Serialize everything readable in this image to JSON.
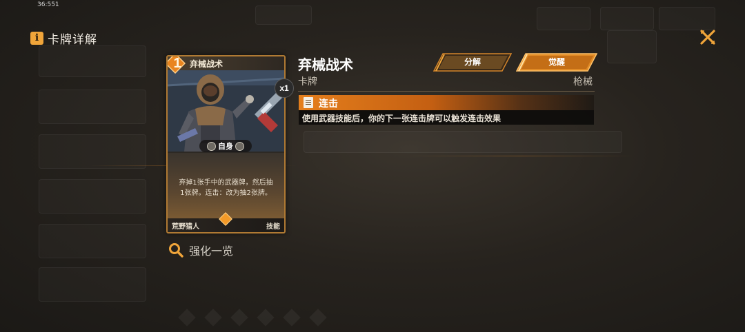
{
  "status": {
    "timestamp": "36:551"
  },
  "panel": {
    "title": "卡牌详解"
  },
  "card": {
    "name": "弃械战术",
    "cost": "1",
    "target": "自身",
    "description_line1": "弃掉1张手中的武器牌，然后抽",
    "description_line2": "1张牌。连击：改为抽2张牌。",
    "faction": "荒野猎人",
    "type": "技能",
    "count": "x1"
  },
  "search": {
    "label": "强化一览"
  },
  "detail": {
    "title": "弃械战术",
    "category": "卡牌",
    "subtype": "枪械",
    "buttons": {
      "decompose": "分解",
      "awaken": "觉醒"
    },
    "keyword": {
      "name": "连击",
      "description": "使用武器技能后，你的下一张连击牌可以触发连击效果"
    }
  },
  "colors": {
    "accent": "#f0a53a",
    "keyword_bar": "#e57f1c"
  }
}
